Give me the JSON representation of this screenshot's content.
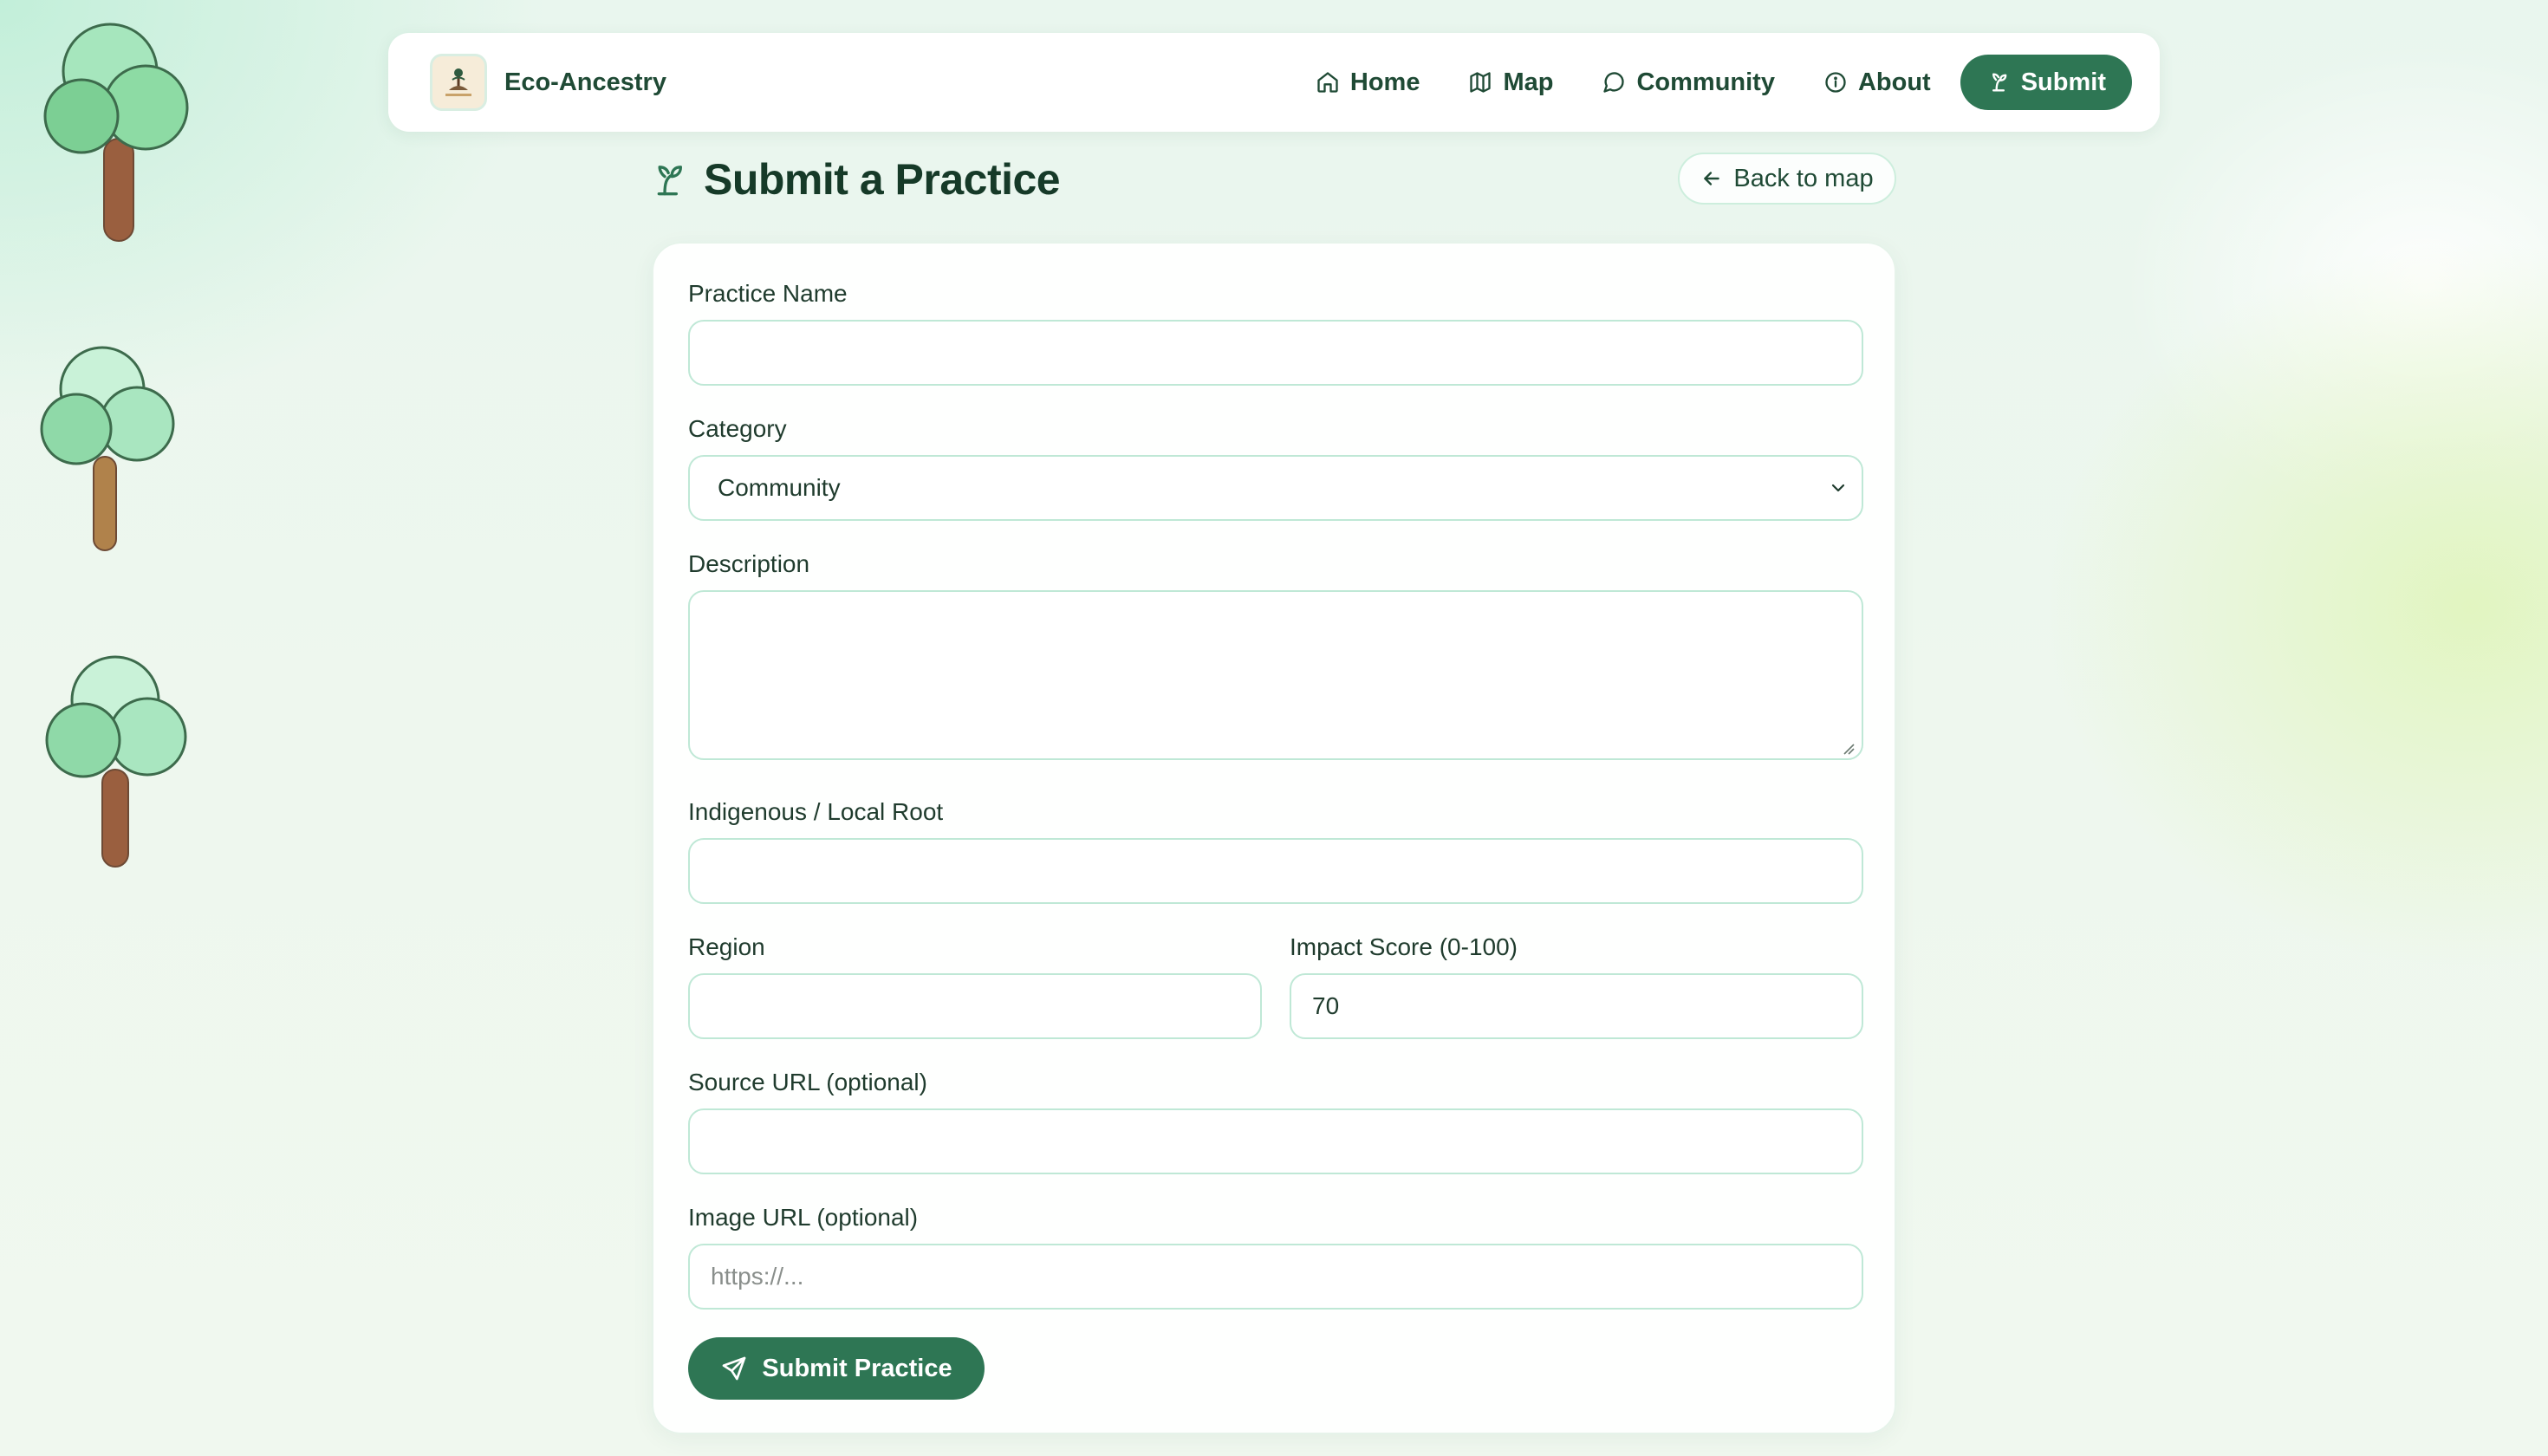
{
  "brand": {
    "name": "Eco-Ancestry",
    "logo_text": "Eco-Ancestry"
  },
  "nav": {
    "items": [
      {
        "label": "Home",
        "icon": "home-icon"
      },
      {
        "label": "Map",
        "icon": "map-icon"
      },
      {
        "label": "Community",
        "icon": "chat-bubble-icon"
      },
      {
        "label": "About",
        "icon": "info-icon"
      }
    ],
    "submit_label": "Submit",
    "submit_icon": "sprout-icon"
  },
  "page": {
    "title": "Submit a Practice",
    "title_icon": "sprout-icon",
    "back_label": "Back to map"
  },
  "form": {
    "practice_name": {
      "label": "Practice Name",
      "value": ""
    },
    "category": {
      "label": "Category",
      "value": "Community"
    },
    "description": {
      "label": "Description",
      "value": ""
    },
    "indigenous_root": {
      "label": "Indigenous / Local Root",
      "value": ""
    },
    "region": {
      "label": "Region",
      "value": ""
    },
    "impact_score": {
      "label": "Impact Score (0-100)",
      "value": "70"
    },
    "source_url": {
      "label": "Source URL (optional)",
      "value": ""
    },
    "image_url": {
      "label": "Image URL (optional)",
      "value": "",
      "placeholder": "https://..."
    },
    "submit_label": "Submit Practice"
  },
  "colors": {
    "accent": "#2e7654",
    "field_border": "#bfe8d6",
    "heading": "#163a28"
  }
}
